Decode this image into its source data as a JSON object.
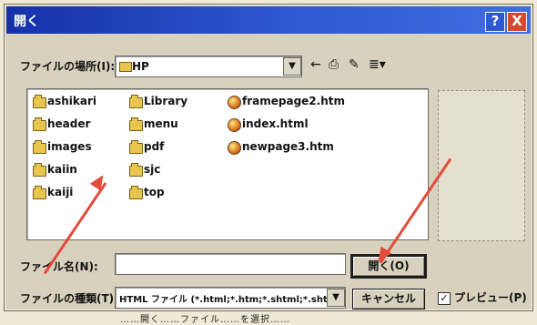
{
  "window": {
    "title": "開く"
  },
  "title_buttons": {
    "help": "?",
    "close": "X"
  },
  "look_in": {
    "label": "ファイルの場所(I):",
    "value": "HP",
    "dropdown_arrow": "▼"
  },
  "toolbar": {
    "back": "←",
    "up": "⎙",
    "new_folder": "✎",
    "views": "≣▾"
  },
  "files": [
    {
      "name": "ashikari",
      "type": "folder"
    },
    {
      "name": "header",
      "type": "folder"
    },
    {
      "name": "images",
      "type": "folder"
    },
    {
      "name": "kaiin",
      "type": "folder"
    },
    {
      "name": "kaiji",
      "type": "folder"
    },
    {
      "name": "Library",
      "type": "folder"
    },
    {
      "name": "menu",
      "type": "folder"
    },
    {
      "name": "pdf",
      "type": "folder"
    },
    {
      "name": "sjc",
      "type": "folder"
    },
    {
      "name": "top",
      "type": "folder"
    },
    {
      "name": "framepage2.htm",
      "type": "html"
    },
    {
      "name": "index.html",
      "type": "html"
    },
    {
      "name": "newpage3.htm",
      "type": "html"
    }
  ],
  "file_name": {
    "label": "ファイル名(N):",
    "value": ""
  },
  "file_type": {
    "label": "ファイルの種類(T):",
    "value": "HTML ファイル (*.html;*.htm;*.shtml;*.shtm)",
    "dropdown_arrow": "▼"
  },
  "buttons": {
    "open": "開く(O)",
    "cancel": "キャンセル"
  },
  "preview": {
    "checked": true,
    "label": "プレビュー(P)"
  },
  "footnote": "……開く……ファイル……を選択……"
}
